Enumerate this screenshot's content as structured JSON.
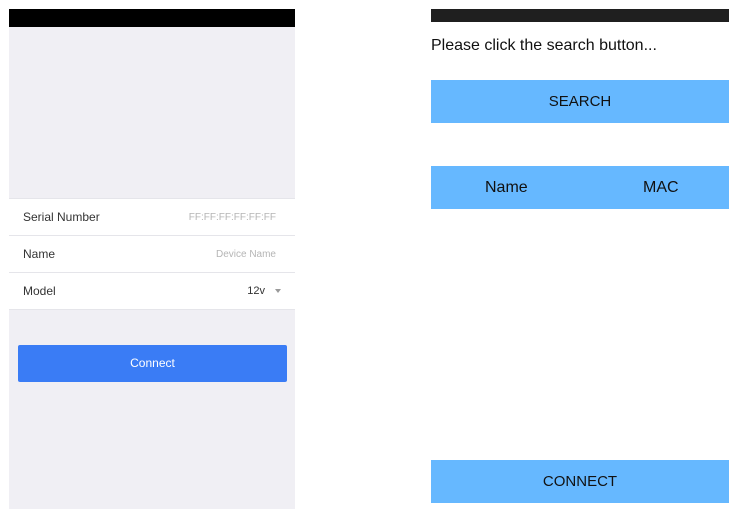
{
  "left_screen": {
    "form": {
      "serial_number": {
        "label": "Serial Number",
        "placeholder": "FF:FF:FF:FF:FF:FF"
      },
      "name": {
        "label": "Name",
        "placeholder": "Device Name"
      },
      "model": {
        "label": "Model",
        "selected": "12v"
      }
    },
    "connect_label": "Connect",
    "colors": {
      "accent": "#3a7cf5",
      "background": "#f0eff4"
    }
  },
  "right_screen": {
    "prompt": "Please click the search button...",
    "search_label": "SEARCH",
    "list_header": {
      "name": "Name",
      "mac": "MAC"
    },
    "connect_label": "CONNECT",
    "colors": {
      "accent": "#66b8ff"
    }
  }
}
